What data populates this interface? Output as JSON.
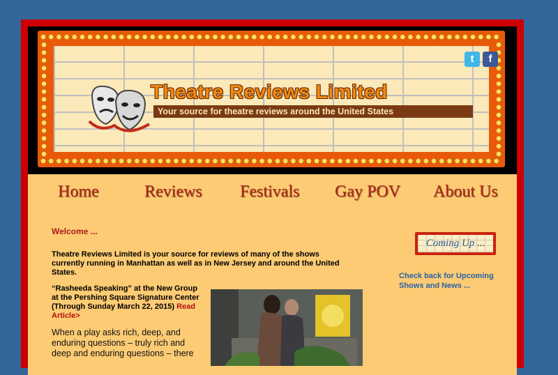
{
  "header": {
    "title": "Theatre Reviews Limited",
    "tagline": "Your source for theatre reviews around the United States",
    "social": [
      {
        "name": "twitter",
        "glyph": "t"
      },
      {
        "name": "facebook",
        "glyph": "f"
      }
    ]
  },
  "nav": {
    "items": [
      {
        "label": "Home"
      },
      {
        "label": "Reviews"
      },
      {
        "label": "Festivals"
      },
      {
        "label": "Gay POV"
      },
      {
        "label": "About Us"
      }
    ]
  },
  "main": {
    "welcome": "Welcome ...",
    "intro": "Theatre Reviews Limited is your source for reviews of many of the shows currently running in Manhattan as well as in New Jersey and around the United States.",
    "article": {
      "headline": "“Rasheeda Speaking” at the New Group at the Pershing Square Signature Center (Through Sunday March 22, 2015)",
      "read_more": "Read Article>",
      "body": "When a play asks rich, deep, and enduring questions – truly rich and deep and enduring questions – there"
    }
  },
  "sidebar": {
    "coming_up": "Coming Up ...",
    "upcoming_text": "Check back for Upcoming Shows and News ..."
  },
  "colors": {
    "page_bg": "#336699",
    "frame_red": "#cc0000",
    "content_bg": "#fdcb74",
    "nav_text": "#b22418",
    "link_blue": "#2a62a7"
  }
}
